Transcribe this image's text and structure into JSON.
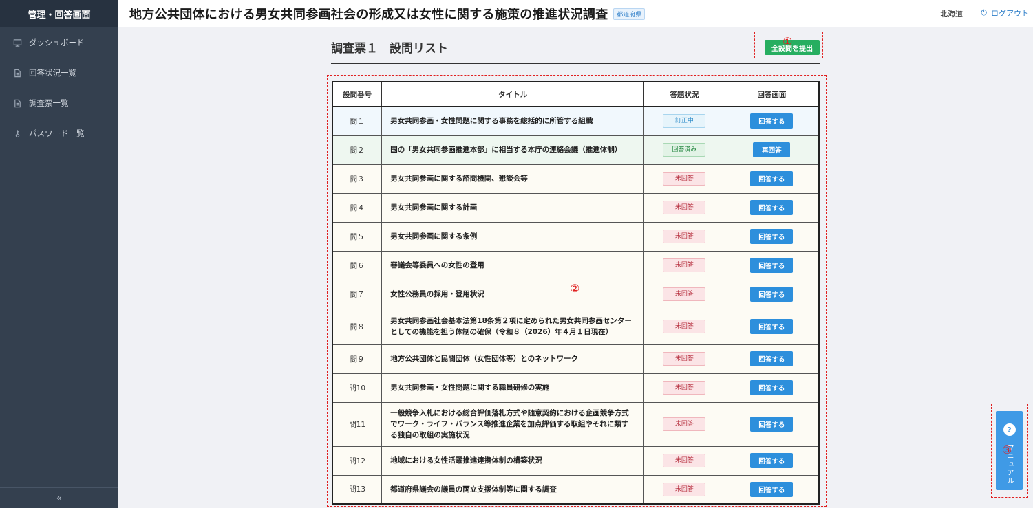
{
  "sidebar": {
    "header": "管理・回答画面",
    "items": [
      {
        "label": "ダッシュボード",
        "icon": "dashboard-icon"
      },
      {
        "label": "回答状況一覧",
        "icon": "document-icon"
      },
      {
        "label": "調査票一覧",
        "icon": "document-icon"
      },
      {
        "label": "パスワード一覧",
        "icon": "key-icon"
      }
    ],
    "collapse_glyph": "«"
  },
  "header": {
    "title": "地方公共団体における男女共同参画社会の形成又は女性に関する施策の推進状況調査",
    "badge": "都道府県",
    "prefecture": "北海道",
    "logout": "ログアウト"
  },
  "main": {
    "title": "調査票１　設問リスト",
    "submit_label": "全設問を提出",
    "markers": {
      "m1": "①",
      "m2": "②",
      "m3": "③"
    }
  },
  "table": {
    "headers": [
      "設問番号",
      "タイトル",
      "答題状況",
      "回答画面"
    ],
    "rows": [
      {
        "num": "問１",
        "title": "男女共同参画・女性問題に関する事務を総括的に所管する組織",
        "status": "訂正中",
        "status_type": "editing",
        "action": "回答する"
      },
      {
        "num": "問２",
        "title": "国の「男女共同参画推進本部」に相当する本庁の連絡会議（推進体制）",
        "status": "回答済み",
        "status_type": "answered",
        "action": "再回答"
      },
      {
        "num": "問３",
        "title": "男女共同参画に関する諮問機関、懇談会等",
        "status": "未回答",
        "status_type": "unanswered",
        "action": "回答する"
      },
      {
        "num": "問４",
        "title": "男女共同参画に関する計画",
        "status": "未回答",
        "status_type": "unanswered",
        "action": "回答する"
      },
      {
        "num": "問５",
        "title": "男女共同参画に関する条例",
        "status": "未回答",
        "status_type": "unanswered",
        "action": "回答する"
      },
      {
        "num": "問６",
        "title": "審議会等委員への女性の登用",
        "status": "未回答",
        "status_type": "unanswered",
        "action": "回答する"
      },
      {
        "num": "問７",
        "title": "女性公務員の採用・登用状況",
        "status": "未回答",
        "status_type": "unanswered",
        "action": "回答する"
      },
      {
        "num": "問８",
        "title": "男女共同参画社会基本法第18条第２項に定められた男女共同参画センターとしての機能を担う体制の確保（令和８（2026）年４月１日現在）",
        "status": "未回答",
        "status_type": "unanswered",
        "action": "回答する"
      },
      {
        "num": "問９",
        "title": "地方公共団体と民間団体（女性団体等）とのネットワーク",
        "status": "未回答",
        "status_type": "unanswered",
        "action": "回答する"
      },
      {
        "num": "問10",
        "title": "男女共同参画・女性問題に関する職員研修の実施",
        "status": "未回答",
        "status_type": "unanswered",
        "action": "回答する"
      },
      {
        "num": "問11",
        "title": "一般競争入札における総合評価落札方式や随意契約における企画競争方式でワーク・ライフ・バランス等推進企業を加点評価する取組やそれに類する独自の取組の実施状況",
        "status": "未回答",
        "status_type": "unanswered",
        "action": "回答する"
      },
      {
        "num": "問12",
        "title": "地域における女性活躍推進連携体制の構築状況",
        "status": "未回答",
        "status_type": "unanswered",
        "action": "回答する"
      },
      {
        "num": "問13",
        "title": "都道府県議会の議員の両立支援体制等に関する調査",
        "status": "未回答",
        "status_type": "unanswered",
        "action": "回答する"
      }
    ]
  },
  "manual": {
    "help_glyph": "?",
    "label": "マニュアル"
  },
  "colors": {
    "sidebar_bg": "#34404f",
    "submit_green": "#27ae60",
    "action_blue": "#2d8fdc",
    "annotation_red": "#e02020"
  }
}
